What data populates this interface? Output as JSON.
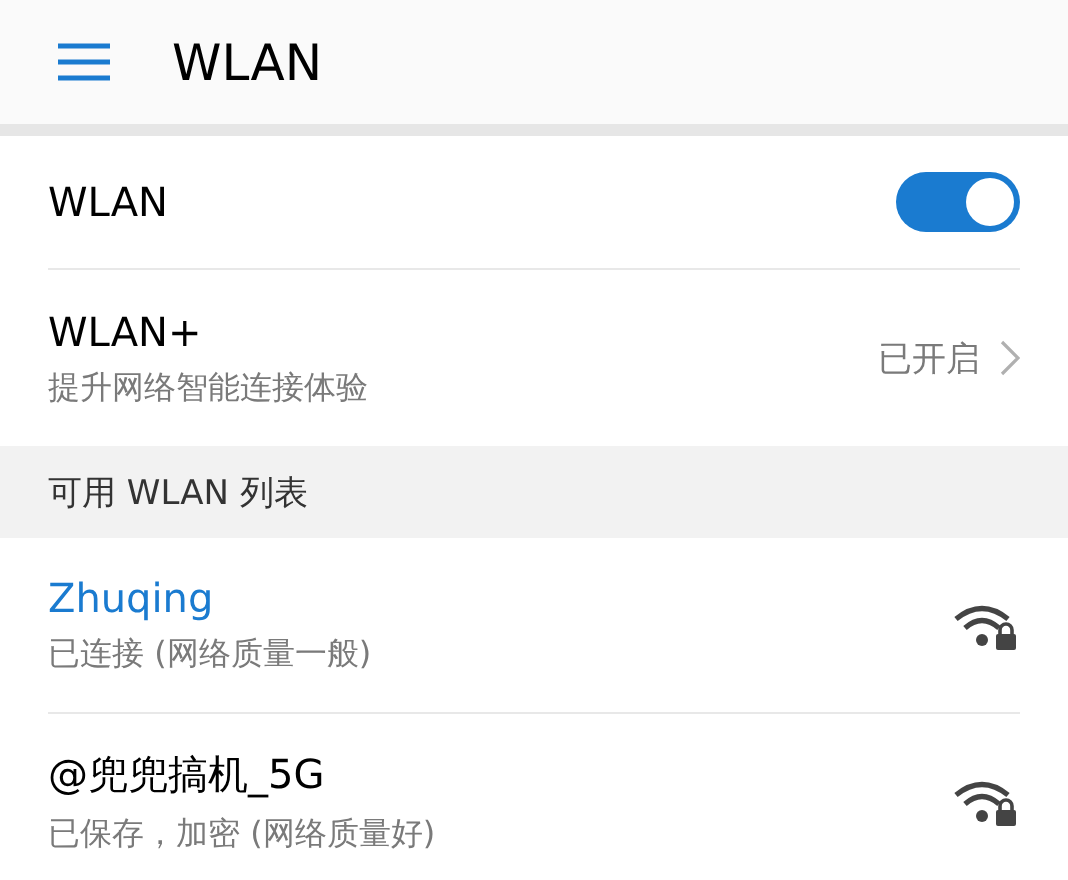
{
  "header": {
    "title": "WLAN"
  },
  "wlan": {
    "label": "WLAN",
    "on": true
  },
  "wlan_plus": {
    "label": "WLAN+",
    "description": "提升网络智能连接体验",
    "status": "已开启"
  },
  "section": {
    "title": "可用 WLAN 列表"
  },
  "networks": [
    {
      "name": "Zhuqing",
      "status": "已连接 (网络质量一般)",
      "selected": true,
      "secured": true
    },
    {
      "name": "@兜兜搞机_5G",
      "status": "已保存，加密 (网络质量好)",
      "selected": false,
      "secured": true
    }
  ]
}
